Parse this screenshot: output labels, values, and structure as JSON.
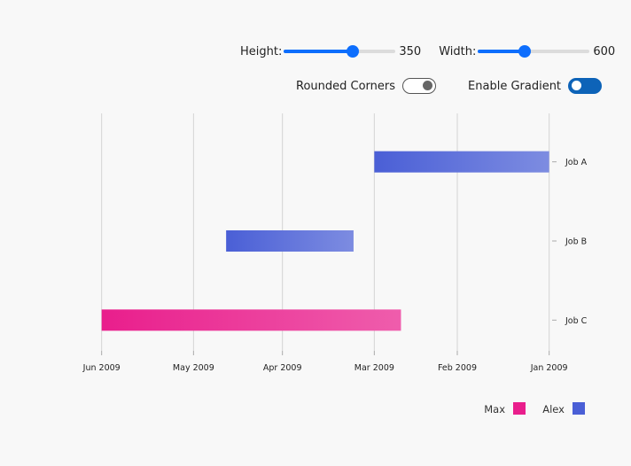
{
  "controls": {
    "height_label": "Height:",
    "height_value": "350",
    "height_fraction": 0.62,
    "width_label": "Width:",
    "width_value": "600",
    "width_fraction": 0.42,
    "rounded_label": "Rounded Corners",
    "rounded_on": false,
    "gradient_label": "Enable Gradient",
    "gradient_on": true
  },
  "chart_data": {
    "type": "gantt",
    "x_reversed": true,
    "x_ticks": [
      "Jun 2009",
      "May 2009",
      "Apr 2009",
      "Mar 2009",
      "Feb 2009",
      "Jan 2009"
    ],
    "x_tick_dates": [
      "2009-06-01",
      "2009-05-01",
      "2009-04-01",
      "2009-03-01",
      "2009-02-01",
      "2009-01-01"
    ],
    "x_range": [
      "2009-06-03",
      "2008-12-31"
    ],
    "categories": [
      "Job A",
      "Job B",
      "Job C"
    ],
    "tasks": [
      {
        "category": "Job A",
        "start": "2009-01-01",
        "end": "2009-03-01",
        "owner": "Alex"
      },
      {
        "category": "Job B",
        "start": "2009-03-08",
        "end": "2009-04-20",
        "owner": "Alex"
      },
      {
        "category": "Job C",
        "start": "2009-02-20",
        "end": "2009-06-01",
        "owner": "Max"
      }
    ],
    "legend": [
      {
        "name": "Max",
        "color": "#e91e8c"
      },
      {
        "name": "Alex",
        "color": "#4a5fd6"
      }
    ],
    "grid": true,
    "legend_placement": "bottom-right"
  }
}
